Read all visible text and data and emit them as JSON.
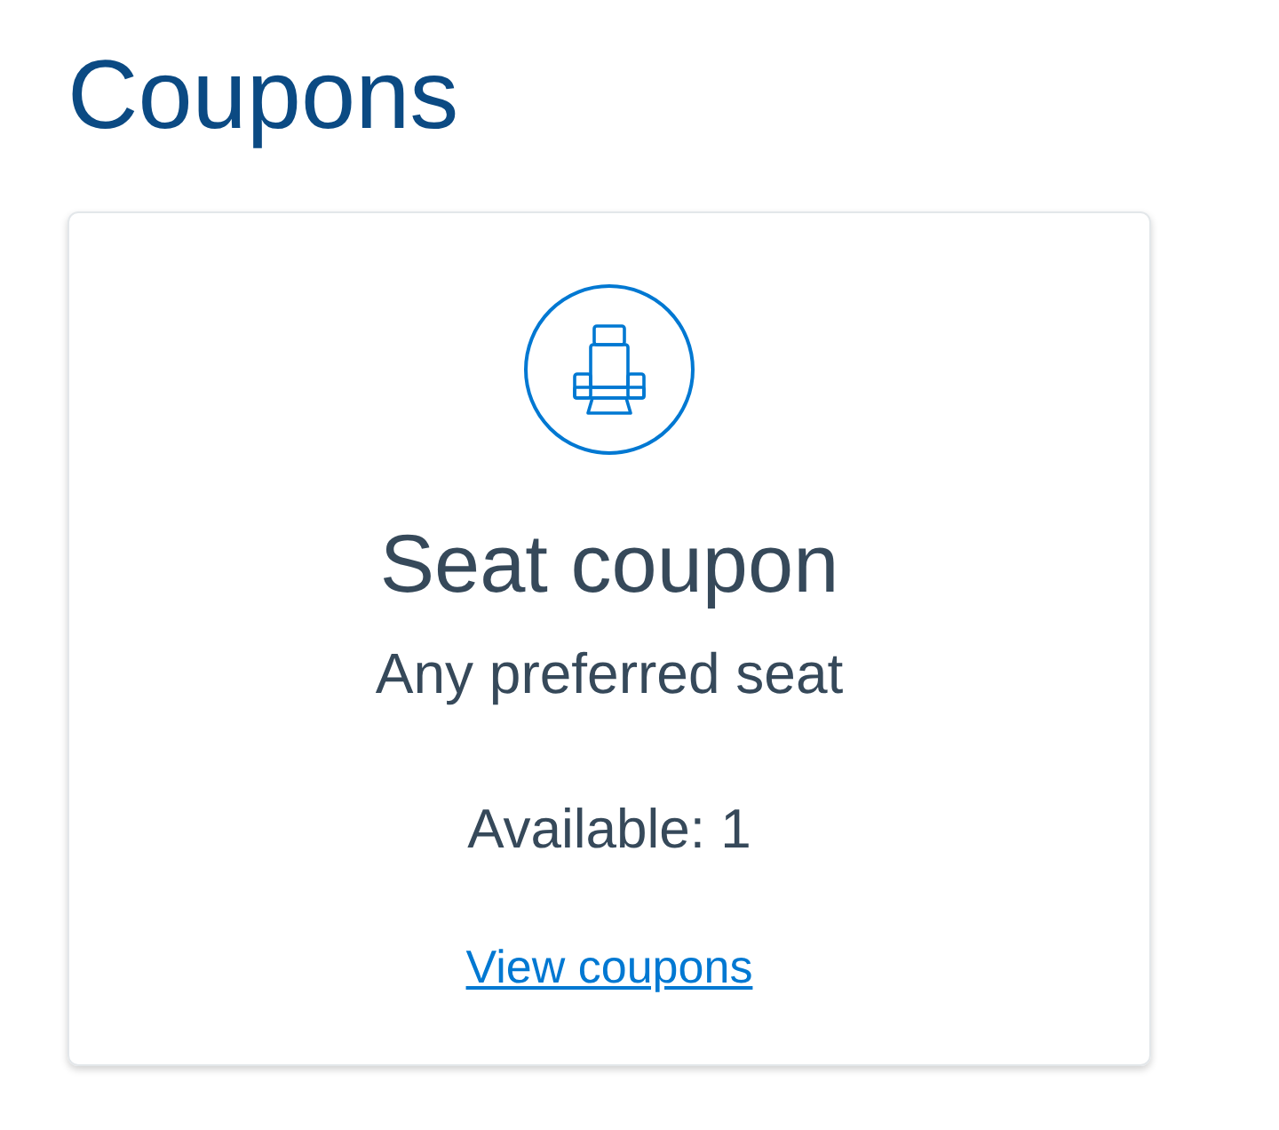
{
  "page": {
    "title": "Coupons"
  },
  "coupons": [
    {
      "title": "Seat coupon",
      "description": "Any preferred seat",
      "availability": "Available: 1",
      "link": "View coupons"
    }
  ]
}
